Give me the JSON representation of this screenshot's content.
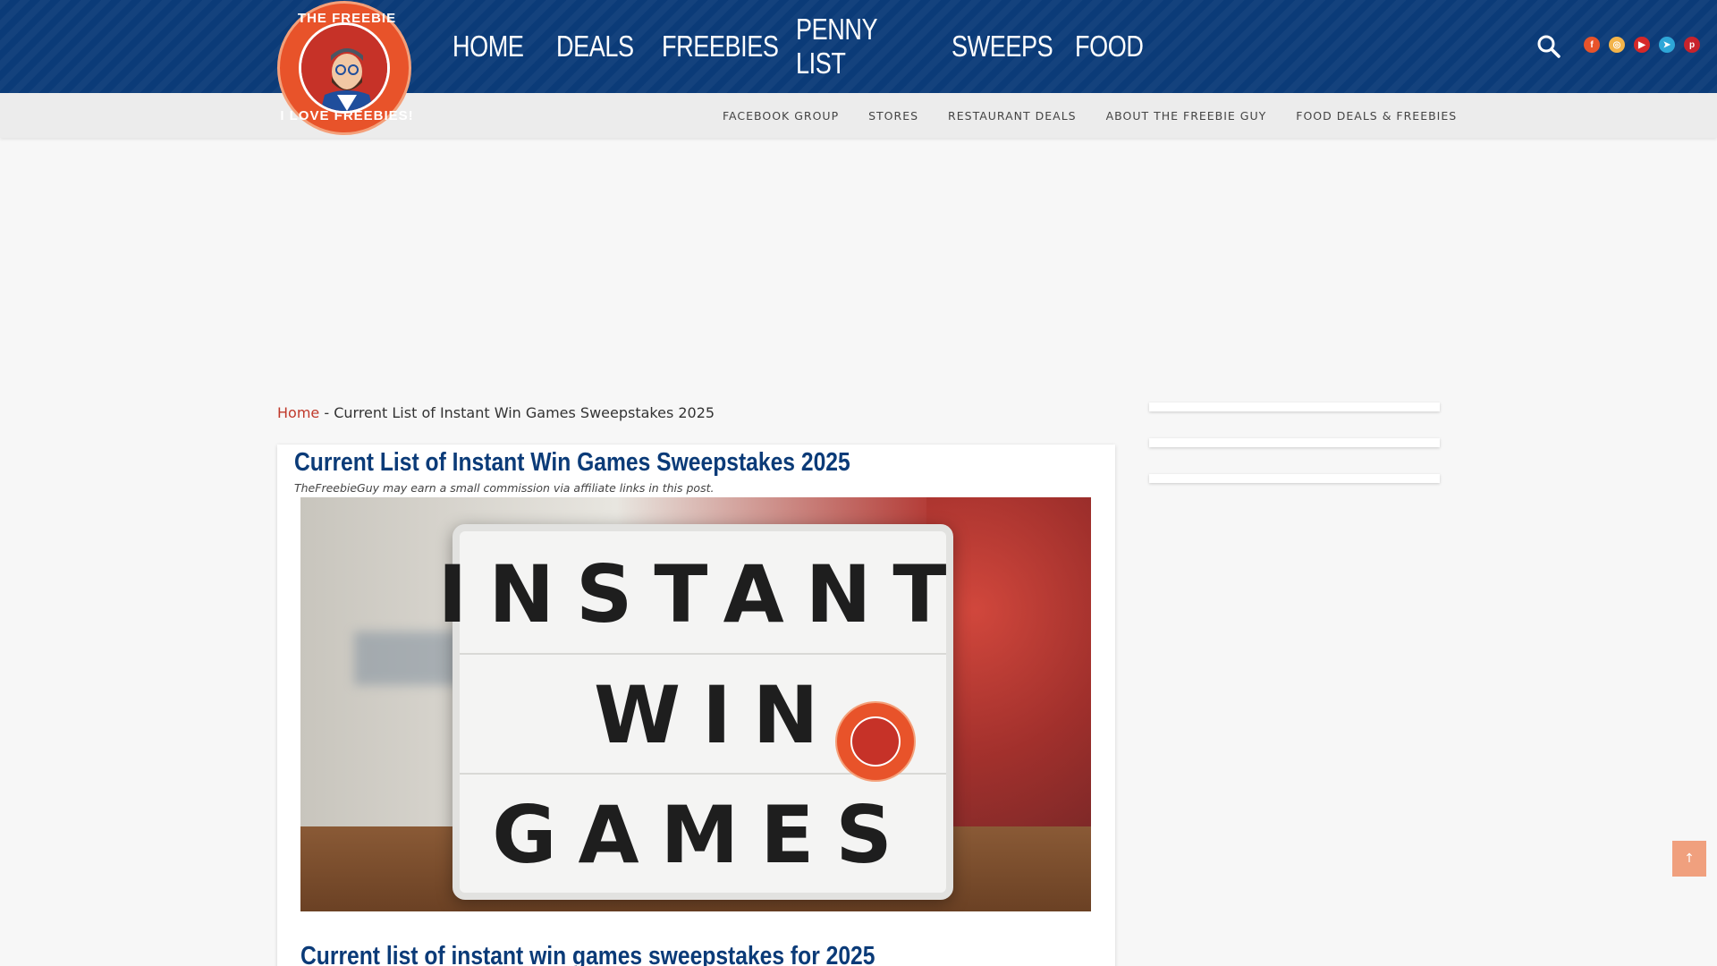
{
  "header": {
    "logo": {
      "text_top": "THE FREEBIE GUY",
      "text_bottom": "I LOVE FREEBIES!"
    },
    "nav": [
      {
        "label": "HOME"
      },
      {
        "label": "DEALS"
      },
      {
        "label": "FREEBIES"
      },
      {
        "label": "PENNY LIST"
      },
      {
        "label": "SWEEPS"
      },
      {
        "label": "FOOD"
      }
    ],
    "search_icon": "search-icon",
    "socials": [
      {
        "icon": "facebook-icon",
        "glyph": "f",
        "color": "#e8532a"
      },
      {
        "icon": "instagram-icon",
        "glyph": "◎",
        "color": "#f3b44a"
      },
      {
        "icon": "youtube-icon",
        "glyph": "▶",
        "color": "#d62828"
      },
      {
        "icon": "telegram-icon",
        "glyph": "➤",
        "color": "#2ea7d8"
      },
      {
        "icon": "pinterest-icon",
        "glyph": "p",
        "color": "#c8232c"
      }
    ]
  },
  "subnav": [
    {
      "label": "FACEBOOK GROUP"
    },
    {
      "label": "STORES"
    },
    {
      "label": "RESTAURANT DEALS"
    },
    {
      "label": "ABOUT THE FREEBIE GUY"
    },
    {
      "label": "FOOD DEALS & FREEBIES"
    }
  ],
  "breadcrumb": {
    "home": "Home",
    "separator": " - ",
    "current": "Current List of Instant Win Games Sweepstakes 2025"
  },
  "article": {
    "title": "Current List of Instant Win Games Sweepstakes 2025",
    "disclaimer": "TheFreebieGuy may earn a small commission via affiliate links in this post.",
    "hero": {
      "line1": "INSTANT",
      "line2": "WIN",
      "line3": "GAMES"
    },
    "subtitle": "Current list of instant win games sweepstakes for 2025"
  },
  "back_to_top": "↑",
  "colors": {
    "brand_blue": "#0b3b78",
    "accent_orange": "#e8532a",
    "link_red": "#c0392b"
  }
}
